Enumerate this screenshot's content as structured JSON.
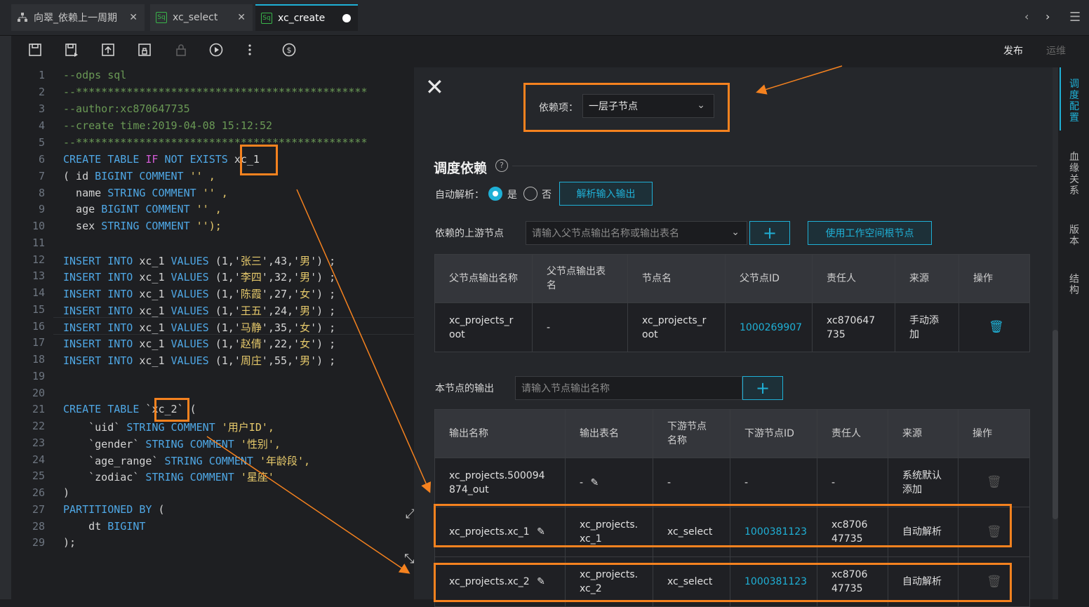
{
  "tabs": [
    {
      "label": "向翠_依赖上一周期",
      "icon": "workflow-icon"
    },
    {
      "label": "xc_select",
      "icon": "sql-icon"
    },
    {
      "label": "xc_create",
      "icon": "sql-icon"
    }
  ],
  "toolbar": {
    "publish": "发布",
    "ops": "运维"
  },
  "editor": {
    "line_numbers": [
      "1",
      "2",
      "3",
      "4",
      "5",
      "6",
      "7",
      "8",
      "9",
      "10",
      "11",
      "12",
      "13",
      "14",
      "15",
      "16",
      "17",
      "18",
      "19",
      "20",
      "21",
      "22",
      "23",
      "24",
      "25",
      "26",
      "27",
      "28",
      "29"
    ],
    "lines": {
      "l1": "--odps sql",
      "l2": "--**********************************************",
      "l3": "--author:xc870647735",
      "l4": "--create time:2019-04-08 15:12:52",
      "l5": "--**********************************************",
      "l6a": "CREATE TABLE ",
      "l6b": "IF",
      "l6c": " NOT EXISTS ",
      "l6d": "xc_1",
      "l7a": "( id ",
      "l7b": "BIGINT COMMENT",
      "l7c": " '' ,",
      "l8a": "  name ",
      "l8b": "STRING COMMENT",
      "l8c": " '' ,",
      "l9a": "  age ",
      "l9b": "BIGINT COMMENT",
      "l9c": " '' ,",
      "l10a": "  sex ",
      "l10b": "STRING COMMENT",
      "l10c": " '');",
      "ins": "INSERT INTO",
      "ins_rows": [
        {
          "a": " xc_1 ",
          "b": "VALUES",
          "c": " (1,'",
          "n": "张三",
          "d": "',43,'",
          "g": "男",
          "e": "') ;"
        },
        {
          "a": " xc_1 ",
          "b": "VALUES",
          "c": " (1,'",
          "n": "李四",
          "d": "',32,'",
          "g": "男",
          "e": "') ;"
        },
        {
          "a": " xc_1 ",
          "b": "VALUES",
          "c": " (1,'",
          "n": "陈霞",
          "d": "',27,'",
          "g": "女",
          "e": "') ;"
        },
        {
          "a": " xc_1 ",
          "b": "VALUES",
          "c": " (1,'",
          "n": "王五",
          "d": "',24,'",
          "g": "男",
          "e": "') ;"
        },
        {
          "a": " xc_1 ",
          "b": "VALUES",
          "c": " (1,'",
          "n": "马静",
          "d": "',35,'",
          "g": "女",
          "e": "') ;"
        },
        {
          "a": " xc_1 ",
          "b": "VALUES",
          "c": " (1,'",
          "n": "赵倩",
          "d": "',22,'",
          "g": "女",
          "e": "') ;"
        },
        {
          "a": " xc_1 ",
          "b": "VALUES",
          "c": " (1,'",
          "n": "周庄",
          "d": "',55,'",
          "g": "男",
          "e": "') ;"
        }
      ],
      "l21a": "CREATE TABLE",
      "l21b": " `",
      "l21c": "xc_2",
      "l21d": "` (",
      "l22a": "    `uid` ",
      "l22b": "STRING COMMENT",
      "l22c": " '用户ID',",
      "l23a": "    `gender` ",
      "l23b": "STRING COMMENT",
      "l23c": " '性别',",
      "l24a": "    `age_range` ",
      "l24b": "STRING COMMENT",
      "l24c": " '年龄段',",
      "l25a": "    `zodiac` ",
      "l25b": "STRING COMMENT",
      "l25c": " '星座'",
      "l26": ")",
      "l27a": "PARTITIONED BY",
      "l27b": " (",
      "l28a": "    dt ",
      "l28b": "BIGINT",
      "l29": ");"
    }
  },
  "panel": {
    "dependency_label": "依赖项：",
    "dependency_value": "一层子节点",
    "section_title": "调度依赖",
    "auto_parse_label": "自动解析：",
    "yes": "是",
    "no": "否",
    "parse_button": "解析输入输出",
    "upstream_label": "依赖的上游节点",
    "upstream_placeholder": "请输入父节点输出名称或输出表名",
    "use_root_button": "使用工作空间根节点",
    "upstream_headers": [
      "父节点输出名称",
      "父节点输出表名",
      "节点名",
      "父节点ID",
      "责任人",
      "来源",
      "操作"
    ],
    "upstream_rows": [
      {
        "output": "xc_projects_root",
        "table": "-",
        "node": "xc_projects_root",
        "id": "1000269907",
        "owner": "xc870647735",
        "source": "手动添加"
      }
    ],
    "output_label": "本节点的输出",
    "output_placeholder": "请输入节点输出名称",
    "output_headers": [
      "输出名称",
      "输出表名",
      "下游节点名称",
      "下游节点ID",
      "责任人",
      "来源",
      "操作"
    ],
    "output_rows": [
      {
        "name": "xc_projects.500094874_out",
        "table": "-",
        "down_name": "-",
        "down_id": "-",
        "owner": "-",
        "source": "系统默认添加"
      },
      {
        "name": "xc_projects.xc_1",
        "table": "xc_projects.xc_1",
        "down_name": "xc_select",
        "down_id": "1000381123",
        "owner": "xc870647735",
        "source": "自动解析"
      },
      {
        "name": "xc_projects.xc_2",
        "table": "xc_projects.xc_2",
        "down_name": "xc_select",
        "down_id": "1000381123",
        "owner": "xc870647735",
        "source": "自动解析"
      }
    ]
  },
  "right_tabs": [
    "调度配置",
    "血缘关系",
    "版本",
    "结构"
  ],
  "colors": {
    "accent": "#1fb0d6",
    "highlight": "#f5821f",
    "background": "#1e1f22"
  }
}
